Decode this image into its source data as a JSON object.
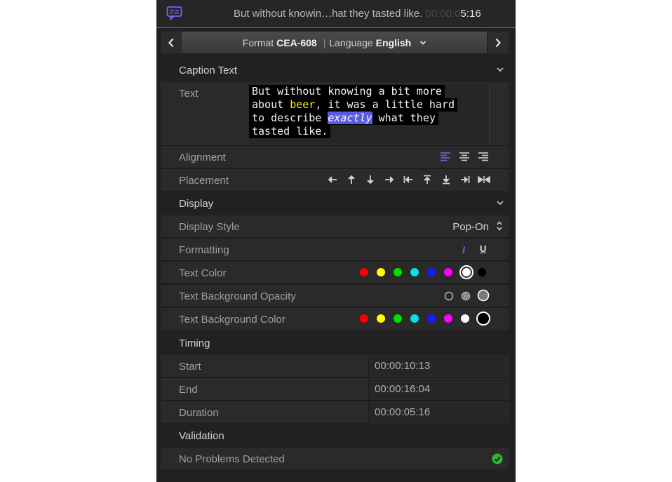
{
  "header": {
    "title_text": "But without knowin…hat they  tasted like.",
    "timecode_dim": "00:00:0",
    "timecode_bright": "5:16"
  },
  "nav": {
    "prev": "‹",
    "next": "›",
    "format_label": "Format",
    "format_value": "CEA-608",
    "separator": "|",
    "language_label": "Language",
    "language_value": "English"
  },
  "caption_text": {
    "section_title": "Caption Text",
    "text_label": "Text",
    "lines": [
      [
        "But without knowing a bit more"
      ],
      [
        "about ",
        "beer",
        ", it was a little hard"
      ],
      [
        "to describe ",
        "exactly",
        " what they"
      ],
      [
        "tasted like."
      ]
    ],
    "alignment_label": "Alignment",
    "placement_label": "Placement"
  },
  "display": {
    "section_title": "Display",
    "display_style_label": "Display Style",
    "display_style_value": "Pop-On",
    "formatting_label": "Formatting",
    "italic_glyph": "I",
    "underline_glyph": "U",
    "text_color_label": "Text Color",
    "text_bg_opacity_label": "Text Background Opacity",
    "text_bg_color_label": "Text Background Color",
    "colors": [
      "#ff0000",
      "#ffff00",
      "#00e000",
      "#00e5e5",
      "#1a1aff",
      "#ff00ff",
      "#ffffff",
      "#000000"
    ]
  },
  "timing": {
    "section_title": "Timing",
    "start_label": "Start",
    "start_value": "00:00:10:13",
    "end_label": "End",
    "end_value": "00:00:16:04",
    "duration_label": "Duration",
    "duration_value": "00:00:05:16"
  },
  "validation": {
    "section_title": "Validation",
    "status_label": "No Problems Detected"
  },
  "accent_color": "#5a5ae6",
  "ok_color": "#2fb82f"
}
